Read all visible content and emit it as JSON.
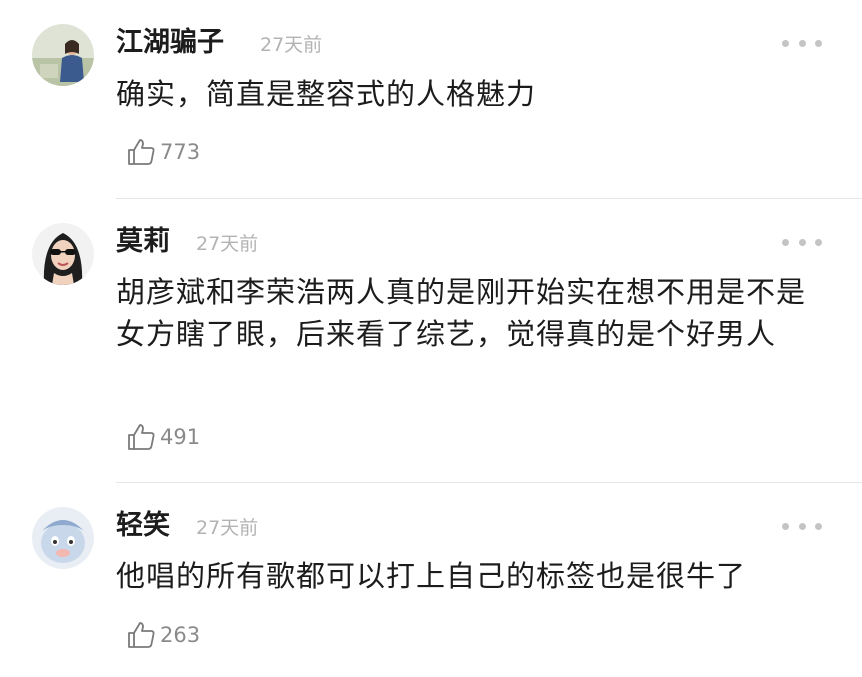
{
  "comments": [
    {
      "username": "江湖骗子",
      "time": "27天前",
      "content": "确实，简直是整容式的人格魅力",
      "likes": "773",
      "avatar": "avatar-woman-seated-outdoors"
    },
    {
      "username": "莫莉",
      "time": "27天前",
      "content": "胡彦斌和李荣浩两人真的是刚开始实在想不用是不是女方瞎了眼，后来看了综艺，觉得真的是个好男人",
      "likes": "491",
      "avatar": "avatar-woman-sunglasses"
    },
    {
      "username": "轻笑",
      "time": "27天前",
      "content": "他唱的所有歌都可以打上自己的标签也是很牛了",
      "likes": "263",
      "avatar": "avatar-cartoon-character"
    }
  ],
  "icons": {
    "like": "thumbs-up-outline-icon",
    "more": "more-dots-icon"
  },
  "colors": {
    "text": "#1c1c1c",
    "meta": "#b3b3b3",
    "like_count": "#8a8a8a",
    "divider": "#e6e6e6"
  }
}
